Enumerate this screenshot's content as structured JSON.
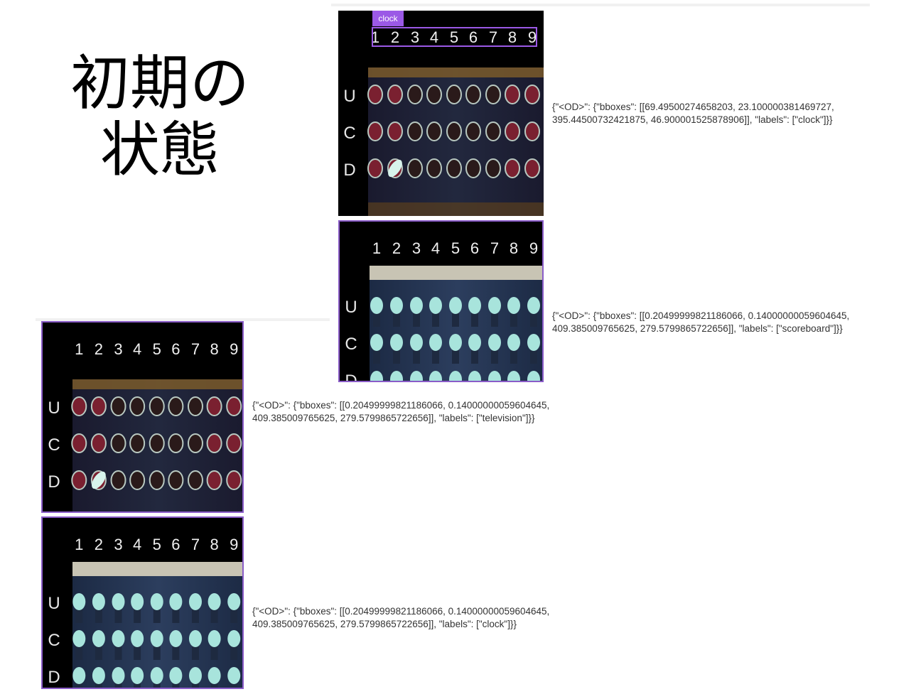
{
  "title": {
    "line1": "初期の",
    "line2": "状態"
  },
  "panels": [
    {
      "id": "top-clock",
      "numbers": [
        "1",
        "2",
        "3",
        "4",
        "5",
        "6",
        "7",
        "8",
        "9"
      ],
      "rows": [
        "U",
        "C",
        "D"
      ],
      "detection_label": "clock",
      "style": "dark",
      "json_line1": "{\"<OD>\": {\"bboxes\": [[69.49500274658203, 23.100000381469727,",
      "json_line2": "395.44500732421875, 46.900001525878906]], \"labels\": [\"clock\"]}}"
    },
    {
      "id": "top-scoreboard",
      "numbers": [
        "1",
        "2",
        "3",
        "4",
        "5",
        "6",
        "7",
        "8",
        "9"
      ],
      "rows": [
        "U",
        "C",
        "D"
      ],
      "style": "light",
      "json_line1": "{\"<OD>\": {\"bboxes\": [[0.20499999821186066, 0.14000000059604645,",
      "json_line2": "409.385009765625, 279.5799865722656]], \"labels\": [\"scoreboard\"]}}"
    },
    {
      "id": "bottom-television",
      "numbers": [
        "1",
        "2",
        "3",
        "4",
        "5",
        "6",
        "7",
        "8",
        "9"
      ],
      "rows": [
        "U",
        "C",
        "D"
      ],
      "style": "dark",
      "json_line1": "{\"<OD>\": {\"bboxes\": [[0.20499999821186066, 0.14000000059604645,",
      "json_line2": "409.385009765625, 279.5799865722656]], \"labels\": [\"television\"]}}"
    },
    {
      "id": "bottom-clock",
      "numbers": [
        "1",
        "2",
        "3",
        "4",
        "5",
        "6",
        "7",
        "8",
        "9"
      ],
      "rows": [
        "U",
        "C",
        "D"
      ],
      "style": "light",
      "json_line1": "{\"<OD>\": {\"bboxes\": [[0.20499999821186066, 0.14000000059604645,",
      "json_line2": "409.385009765625, 279.5799865722656]], \"labels\": [\"clock\"]}}"
    }
  ],
  "colors": {
    "dark_tube_fill": "#2a1a1a",
    "dark_tube_ring": "#b8c8c0",
    "dark_tube_red": "#7a2030",
    "light_tube_fill": "#a8e4dc",
    "panel_purple": "#8a5cc8",
    "label_purple": "#9b59e6"
  }
}
